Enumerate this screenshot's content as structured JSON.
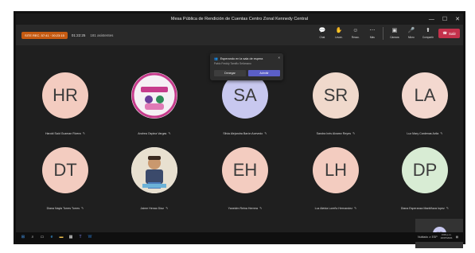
{
  "window": {
    "title": "Mesa Pública de Rendición de Cuentas Centro Zonal Kennedy Central",
    "controls": [
      "—",
      "☐",
      "✕"
    ]
  },
  "toolbar": {
    "recording_badge": "SITE REC. 57:41 · 00:23:15",
    "timer": "01:22:25",
    "participants_count": "181 asistentes",
    "tools": [
      {
        "icon": "chat-icon",
        "glyph": "💬",
        "label": "Chat"
      },
      {
        "icon": "raise-hand-icon",
        "glyph": "✋",
        "label": "Levan."
      },
      {
        "icon": "react-icon",
        "glyph": "☺",
        "label": "Reacc."
      },
      {
        "icon": "more-icon",
        "glyph": "⋯",
        "label": "Más"
      },
      {
        "icon": "camera-icon",
        "glyph": "▣",
        "label": "Cámara"
      },
      {
        "icon": "mic-icon",
        "glyph": "🎤",
        "label": "Micro"
      },
      {
        "icon": "share-icon",
        "glyph": "⬆",
        "label": "Compartir"
      }
    ],
    "leave_label": "Salir"
  },
  "lobby": {
    "title": "Esperando en la sala de espera",
    "person": "Pablo Freddy Tamiño Selómano",
    "deny_label": "Denegar",
    "admit_label": "Admitir"
  },
  "participants": [
    {
      "initials": "HR",
      "name": "Harold Said Guzman Rivera",
      "color": "#f3ccc0",
      "kind": "initials"
    },
    {
      "initials": "",
      "name": "Andrea Ospina Vargas",
      "color": "#ffffff",
      "kind": "logo"
    },
    {
      "initials": "SA",
      "name": "Silvia Alejandra Barón Acevedo",
      "color": "#c8c8ef",
      "kind": "initials"
    },
    {
      "initials": "SR",
      "name": "Sandra Inés Alvarez Reyes",
      "color": "#f0d9cc",
      "kind": "initials"
    },
    {
      "initials": "LA",
      "name": "Luz Mary Cardenas Avila",
      "color": "#f3d8cf",
      "kind": "initials"
    },
    {
      "initials": "DT",
      "name": "Diana Nayla Torres Torres",
      "color": "#f3ccc0",
      "kind": "initials"
    },
    {
      "initials": "",
      "name": "Jaime Henao Díaz",
      "color": "#e8e0d0",
      "kind": "photo"
    },
    {
      "initials": "EH",
      "name": "Yaneidm Reina Herrera",
      "color": "#f3ccc0",
      "kind": "initials"
    },
    {
      "initials": "LH",
      "name": "Luz Aleida Loreño Hernandez",
      "color": "#f3ccc0",
      "kind": "initials"
    },
    {
      "initials": "DP",
      "name": "Diana Esperanza Mantiñaza Iopez",
      "color": "#d8ecd4",
      "kind": "initials"
    }
  ],
  "self_view": {
    "initials": "YC"
  },
  "taskbar": {
    "icons": [
      "windows-icon",
      "search-icon",
      "task-view-icon",
      "edge-icon",
      "explorer-icon",
      "store-icon",
      "teams-icon",
      "word-icon"
    ],
    "tray_text": "Nublado ∧ ESP",
    "time": "3:06 p.m.",
    "date": "16/07/2021"
  }
}
